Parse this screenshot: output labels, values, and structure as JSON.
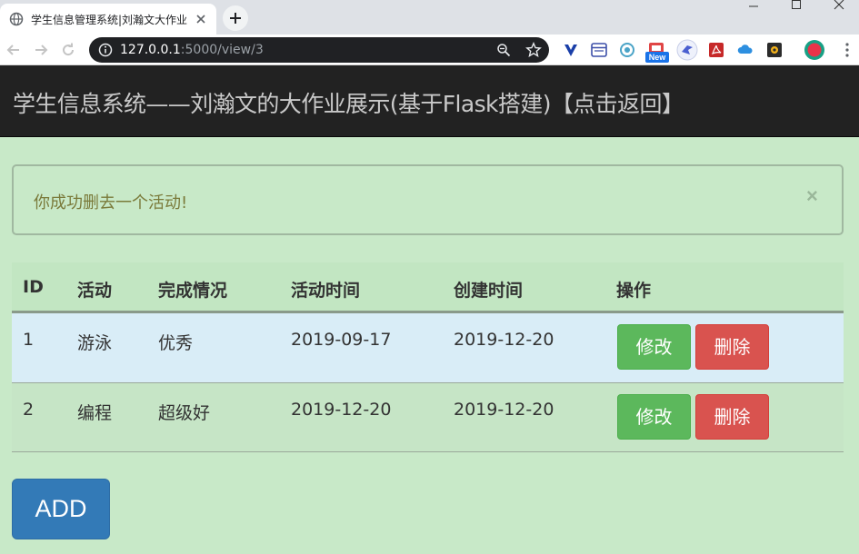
{
  "browser": {
    "tab_title": "学生信息管理系统|刘瀚文大作业",
    "url_host": "127.0.0.1",
    "url_path": ":5000/view/3",
    "ext_new_badge": "New"
  },
  "navbar": {
    "brand": "学生信息系统——刘瀚文的大作业展示(基于Flask搭建)【点击返回】"
  },
  "alert": {
    "message": "你成功删去一个活动!",
    "close_symbol": "×"
  },
  "table": {
    "headers": [
      "ID",
      "活动",
      "完成情况",
      "活动时间",
      "创建时间",
      "操作"
    ],
    "rows": [
      {
        "id": "1",
        "activity": "游泳",
        "status": "优秀",
        "activity_time": "2019-09-17",
        "created_time": "2019-12-20",
        "edit_label": "修改",
        "delete_label": "删除"
      },
      {
        "id": "2",
        "activity": "编程",
        "status": "超级好",
        "activity_time": "2019-12-20",
        "created_time": "2019-12-20",
        "edit_label": "修改",
        "delete_label": "删除"
      }
    ]
  },
  "add_button": {
    "label": "ADD"
  },
  "colors": {
    "page_bg": "#c8e9c8",
    "navbar_bg": "#222222",
    "edit_btn": "#5cb85c",
    "delete_btn": "#d9534f",
    "add_btn": "#337ab7",
    "row_highlight": "#d9edf7"
  }
}
